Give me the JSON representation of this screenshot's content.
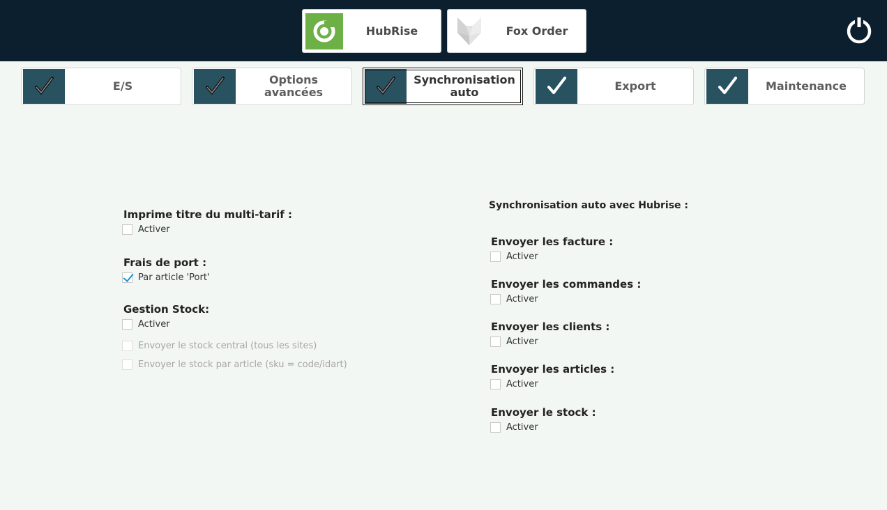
{
  "header": {
    "apps": [
      {
        "label": "HubRise",
        "icon": "hubrise-logo-icon"
      },
      {
        "label": "Fox Order",
        "icon": "fox-logo-icon"
      }
    ],
    "power_icon": "power-icon"
  },
  "tabs": [
    {
      "label": "E/S",
      "icon": "checkmark-icon"
    },
    {
      "label": "Options avancées",
      "icon": "checkmark-icon"
    },
    {
      "label": "Synchronisation auto",
      "icon": "checkmark-icon",
      "active": true
    },
    {
      "label": "Export",
      "icon": "checkmark-icon"
    },
    {
      "label": "Maintenance",
      "icon": "checkmark-icon"
    }
  ],
  "left": {
    "multi_tarif": {
      "title": "Imprime titre du multi-tarif :",
      "option": "Activer",
      "checked": false
    },
    "frais_port": {
      "title": "Frais de port :",
      "option": "Par article 'Port'",
      "checked": true
    },
    "gestion_stock": {
      "title": "Gestion Stock:",
      "option": "Activer",
      "checked": false,
      "sub_central": "Envoyer le stock central (tous les sites)",
      "sub_article": "Envoyer le stock par article (sku = code/idart)"
    }
  },
  "right": {
    "heading": "Synchronisation auto avec Hubrise :",
    "factures": {
      "title": "Envoyer les facture :",
      "option": "Activer"
    },
    "commandes": {
      "title": "Envoyer les commandes :",
      "option": "Activer"
    },
    "clients": {
      "title": "Envoyer les clients :",
      "option": "Activer"
    },
    "articles": {
      "title": "Envoyer les articles :",
      "option": "Activer"
    },
    "stock": {
      "title": "Envoyer le stock :",
      "option": "Activer"
    }
  },
  "colors": {
    "topbar": "#0b1f2e",
    "tab_check_bg": "#295260",
    "hubrise_green": "#6cb046",
    "check_blue": "#1b8fd6",
    "page_bg": "#f3f7f4"
  }
}
